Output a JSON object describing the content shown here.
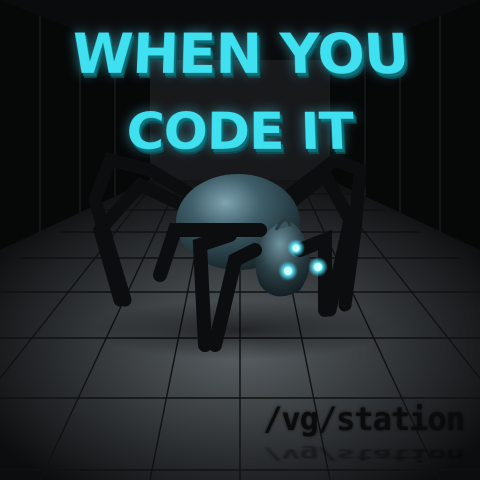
{
  "headline": {
    "line1": "WHEN YOU",
    "line2": "CODE IT"
  },
  "watermark": "/vg/station",
  "colors": {
    "text_cyan": "#3fe0f0",
    "spider_body": "#3f5f6a",
    "eye_glow": "#5ff4ff",
    "floor": "#3a3e41"
  },
  "icons": [
    "spider-robot-illustration"
  ]
}
